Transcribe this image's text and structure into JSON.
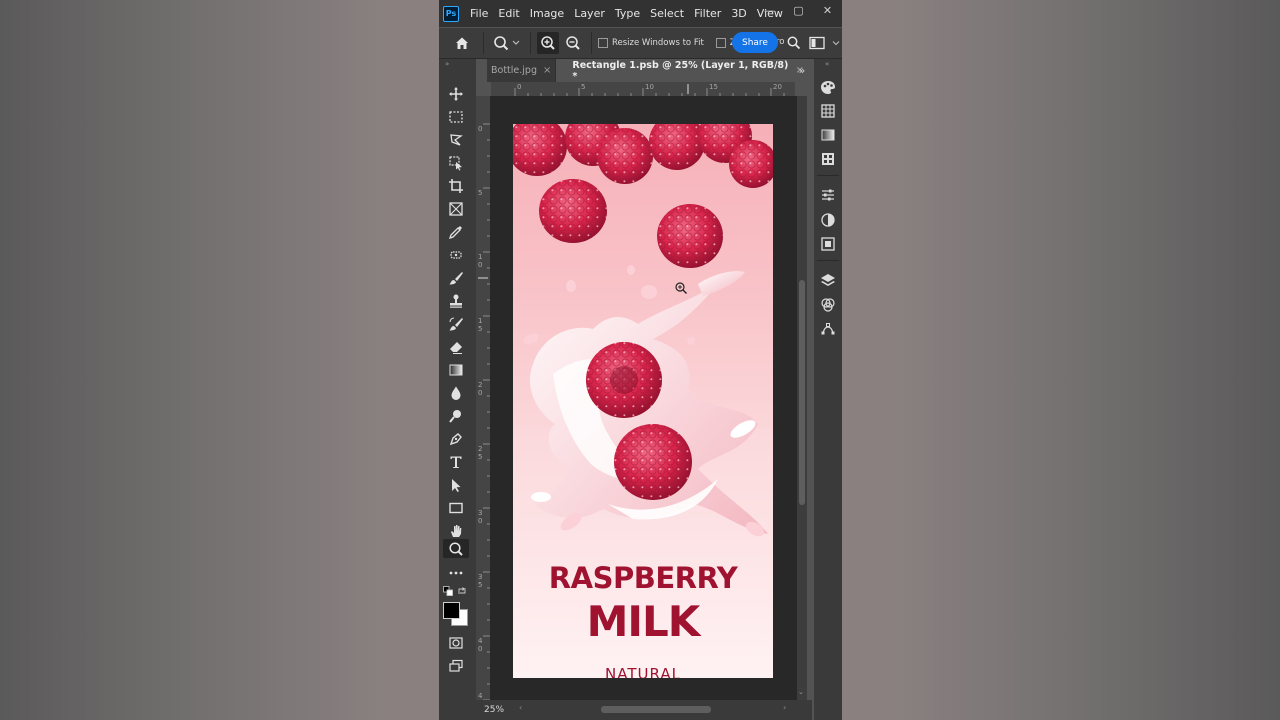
{
  "app": {
    "logo": "Ps"
  },
  "menu": [
    "File",
    "Edit",
    "Image",
    "Layer",
    "Type",
    "Select",
    "Filter",
    "3D",
    "View"
  ],
  "window_controls": {
    "minimize": "—",
    "restore": "▢",
    "close": "✕"
  },
  "options": {
    "resize_windows_label": "Resize Windows to Fit",
    "zoom_all_label": "Zo",
    "zoom_all_suffix": "ro",
    "share_label": "Share"
  },
  "tabs": [
    {
      "label": "Bottle.jpg",
      "active": false
    },
    {
      "label": "Rectangle 1.psb @ 25% (Layer 1, RGB/8) *",
      "active": true
    }
  ],
  "tab_close": "×",
  "ruler": {
    "top": [
      "0",
      "5",
      "10",
      "15",
      "20"
    ],
    "left": [
      "0",
      "5",
      "1 0",
      "1 5",
      "2 0",
      "2 5",
      "3 0",
      "3 5",
      "4 0",
      "4"
    ]
  },
  "document": {
    "line1": "RASPBERRY",
    "line2": "MILK",
    "line3": "NATURAL"
  },
  "status": {
    "zoom": "25%"
  },
  "colors": {
    "accent": "#1473e6",
    "title_red": "#9f1230",
    "raspberry": "#d8244a",
    "foreground_color": "#000000",
    "background_color": "#ffffff"
  },
  "tools": [
    "move",
    "marquee",
    "lasso",
    "object-select",
    "crop",
    "frame",
    "eyedropper",
    "healing",
    "brush",
    "stamp",
    "history-brush",
    "eraser",
    "gradient",
    "blur",
    "dodge",
    "pen",
    "type",
    "path-select",
    "rectangle",
    "hand",
    "zoom",
    "more"
  ],
  "right_panels": [
    "color",
    "swatches",
    "gradients",
    "patterns",
    "adjustments",
    "masks",
    "properties",
    "layers",
    "channels",
    "paths"
  ]
}
